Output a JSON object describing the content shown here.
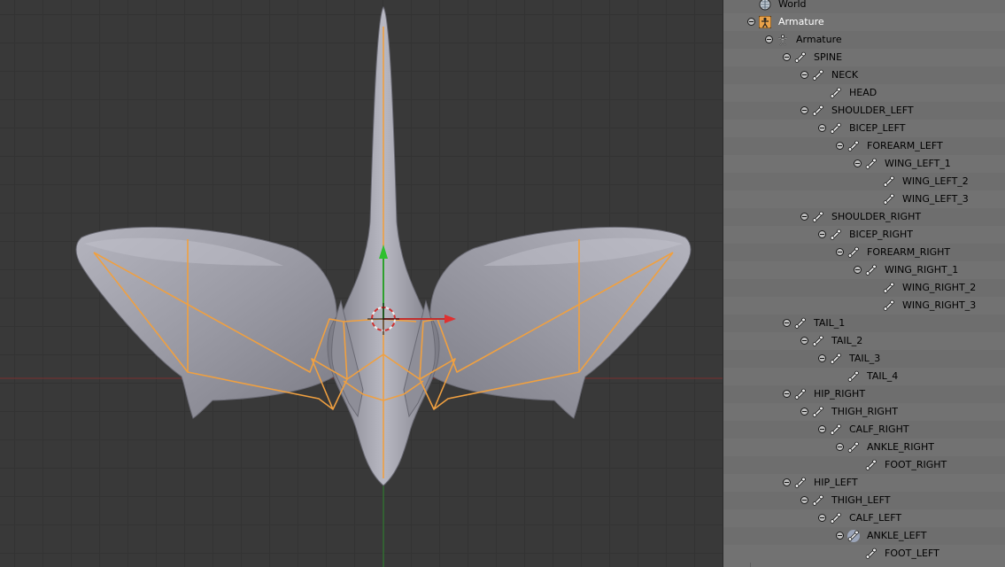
{
  "outliner": {
    "rows": [
      {
        "label": "World",
        "icon": "world-icon",
        "depth": 0,
        "expand": false,
        "selected": false
      },
      {
        "label": "Armature",
        "icon": "armature-object-icon",
        "depth": 0,
        "expand": true,
        "selected": true
      },
      {
        "label": "Armature",
        "icon": "armature-data-icon",
        "depth": 1,
        "expand": true,
        "selected": false
      },
      {
        "label": "SPINE",
        "icon": "bone-icon",
        "depth": 2,
        "expand": true,
        "selected": false
      },
      {
        "label": "NECK",
        "icon": "bone-icon",
        "depth": 3,
        "expand": true,
        "selected": false
      },
      {
        "label": "HEAD",
        "icon": "bone-icon",
        "depth": 4,
        "expand": false,
        "selected": false
      },
      {
        "label": "SHOULDER_LEFT",
        "icon": "bone-icon",
        "depth": 3,
        "expand": true,
        "selected": false
      },
      {
        "label": "BICEP_LEFT",
        "icon": "bone-icon",
        "depth": 4,
        "expand": true,
        "selected": false
      },
      {
        "label": "FOREARM_LEFT",
        "icon": "bone-icon",
        "depth": 5,
        "expand": true,
        "selected": false
      },
      {
        "label": "WING_LEFT_1",
        "icon": "bone-icon",
        "depth": 6,
        "expand": true,
        "selected": false
      },
      {
        "label": "WING_LEFT_2",
        "icon": "bone-icon",
        "depth": 7,
        "expand": false,
        "selected": false
      },
      {
        "label": "WING_LEFT_3",
        "icon": "bone-icon",
        "depth": 7,
        "expand": false,
        "selected": false
      },
      {
        "label": "SHOULDER_RIGHT",
        "icon": "bone-icon",
        "depth": 3,
        "expand": true,
        "selected": false
      },
      {
        "label": "BICEP_RIGHT",
        "icon": "bone-icon",
        "depth": 4,
        "expand": true,
        "selected": false
      },
      {
        "label": "FOREARM_RIGHT",
        "icon": "bone-icon",
        "depth": 5,
        "expand": true,
        "selected": false
      },
      {
        "label": "WING_RIGHT_1",
        "icon": "bone-icon",
        "depth": 6,
        "expand": true,
        "selected": false
      },
      {
        "label": "WING_RIGHT_2",
        "icon": "bone-icon",
        "depth": 7,
        "expand": false,
        "selected": false
      },
      {
        "label": "WING_RIGHT_3",
        "icon": "bone-icon",
        "depth": 7,
        "expand": false,
        "selected": false
      },
      {
        "label": "TAIL_1",
        "icon": "bone-icon",
        "depth": 2,
        "expand": true,
        "selected": false
      },
      {
        "label": "TAIL_2",
        "icon": "bone-icon",
        "depth": 3,
        "expand": true,
        "selected": false
      },
      {
        "label": "TAIL_3",
        "icon": "bone-icon",
        "depth": 4,
        "expand": true,
        "selected": false
      },
      {
        "label": "TAIL_4",
        "icon": "bone-icon",
        "depth": 5,
        "expand": false,
        "selected": false
      },
      {
        "label": "HIP_RIGHT",
        "icon": "bone-icon",
        "depth": 2,
        "expand": true,
        "selected": false
      },
      {
        "label": "THIGH_RIGHT",
        "icon": "bone-icon",
        "depth": 3,
        "expand": true,
        "selected": false
      },
      {
        "label": "CALF_RIGHT",
        "icon": "bone-icon",
        "depth": 4,
        "expand": true,
        "selected": false
      },
      {
        "label": "ANKLE_RIGHT",
        "icon": "bone-icon",
        "depth": 5,
        "expand": true,
        "selected": false
      },
      {
        "label": "FOOT_RIGHT",
        "icon": "bone-icon",
        "depth": 6,
        "expand": false,
        "selected": false
      },
      {
        "label": "HIP_LEFT",
        "icon": "bone-icon",
        "depth": 2,
        "expand": true,
        "selected": false
      },
      {
        "label": "THIGH_LEFT",
        "icon": "bone-icon",
        "depth": 3,
        "expand": true,
        "selected": false
      },
      {
        "label": "CALF_LEFT",
        "icon": "bone-icon",
        "depth": 4,
        "expand": true,
        "selected": false
      },
      {
        "label": "ANKLE_LEFT",
        "icon": "bone-icon-active",
        "depth": 5,
        "expand": true,
        "selected": false
      },
      {
        "label": "FOOT_LEFT",
        "icon": "bone-icon",
        "depth": 6,
        "expand": false,
        "selected": false
      }
    ]
  },
  "colors": {
    "bone_wire": "#f0a040",
    "mesh": "#9c9ca8",
    "x_axis": "#a03030",
    "y_axis": "#3a9a3a",
    "selected_text": "#ffffff"
  }
}
